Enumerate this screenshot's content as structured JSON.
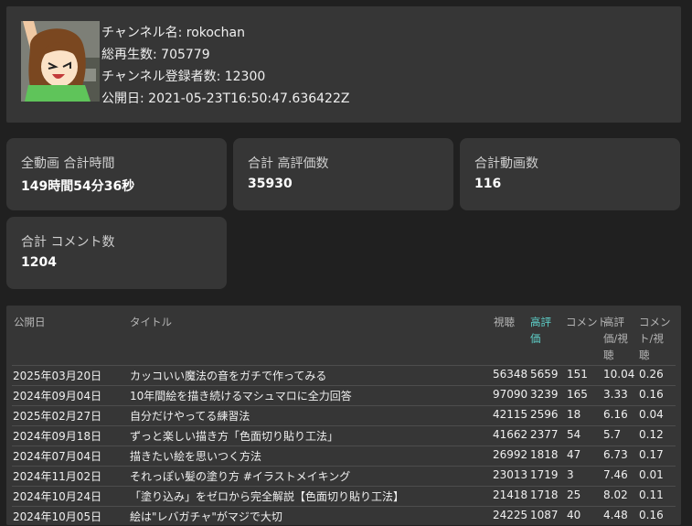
{
  "channel": {
    "name_line": "チャンネル名: rokochan",
    "views_line": "総再生数: 705779",
    "subscribers_line": "チャンネル登録者数: 12300",
    "published_line": "公開日: 2021-05-23T16:50:47.636422Z"
  },
  "stats": [
    {
      "label": "全動画 合計時間",
      "value": "149時間54分36秒"
    },
    {
      "label": "合計 高評価数",
      "value": "35930"
    },
    {
      "label": "合計動画数",
      "value": "116"
    },
    {
      "label": "合計 コメント数",
      "value": "1204"
    }
  ],
  "table": {
    "headers": {
      "date": "公開日",
      "title": "タイトル",
      "views": "視聴",
      "likes": [
        "高評",
        "価"
      ],
      "comments": "コメント",
      "likes_per_view": [
        "高評",
        "価/視",
        "聴"
      ],
      "comments_per_view": [
        "コメン",
        "ト/視",
        "聴"
      ]
    },
    "sorted_column": "likes",
    "sort_color": "#5fd3cc",
    "rows": [
      {
        "date": "2025年03月20日",
        "title": "カッコいい魔法の音をガチで作ってみる",
        "views": "56348",
        "likes": "5659",
        "comments": "151",
        "lpv": "10.04",
        "cpv": "0.26"
      },
      {
        "date": "2024年09月04日",
        "title": "10年間絵を描き続けるマシュマロに全力回答",
        "views": "97090",
        "likes": "3239",
        "comments": "165",
        "lpv": "3.33",
        "cpv": "0.16"
      },
      {
        "date": "2025年02月27日",
        "title": "自分だけやってる練習法",
        "views": "42115",
        "likes": "2596",
        "comments": "18",
        "lpv": "6.16",
        "cpv": "0.04"
      },
      {
        "date": "2024年09月18日",
        "title": "ずっと楽しい描き方「色面切り貼り工法」",
        "views": "41662",
        "likes": "2377",
        "comments": "54",
        "lpv": "5.7",
        "cpv": "0.12"
      },
      {
        "date": "2024年07月04日",
        "title": "描きたい絵を思いつく方法",
        "views": "26992",
        "likes": "1818",
        "comments": "47",
        "lpv": "6.73",
        "cpv": "0.17"
      },
      {
        "date": "2024年11月02日",
        "title": "それっぽい髪の塗り方 #イラストメイキング",
        "views": "23013",
        "likes": "1719",
        "comments": "3",
        "lpv": "7.46",
        "cpv": "0.01"
      },
      {
        "date": "2024年10月24日",
        "title": "「塗り込み」をゼロから完全解説【色面切り貼り工法】",
        "views": "21418",
        "likes": "1718",
        "comments": "25",
        "lpv": "8.02",
        "cpv": "0.11"
      },
      {
        "date": "2024年10月05日",
        "title": "絵は\"レバガチャ\"がマジで大切",
        "views": "24225",
        "likes": "1087",
        "comments": "40",
        "lpv": "4.48",
        "cpv": "0.16"
      }
    ]
  }
}
